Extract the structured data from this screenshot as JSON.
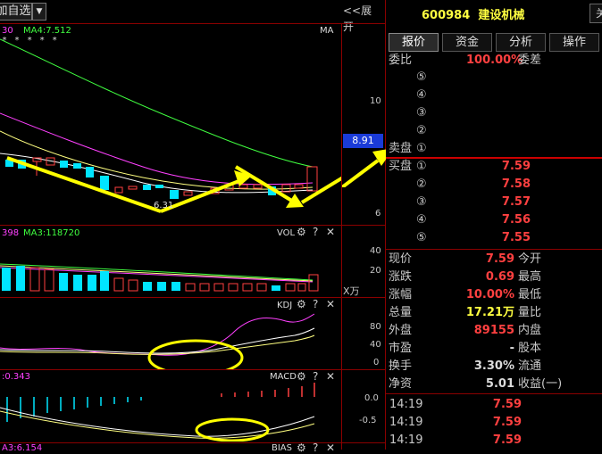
{
  "toolbar": {
    "watchlist_label": "加自选",
    "dropdown_glyph": "▼",
    "expand_label": "<<展开"
  },
  "stock": {
    "code": "600984",
    "name": "建设机械",
    "corner_label": "关"
  },
  "main_chart": {
    "legend_left": "30",
    "legend_ma4": "MA4:7.512",
    "legend_right": "MA",
    "stars": "*   *   * * *",
    "y_ticks": [
      "10",
      "6"
    ],
    "price_badge": "8.91",
    "low_label": "6.31"
  },
  "vol_panel": {
    "legend_left": "398",
    "legend_ma3": "MA3:118720",
    "name": "VOL",
    "y_ticks": [
      "40",
      "20"
    ],
    "unit": "X万"
  },
  "kdj_panel": {
    "name": "KDJ",
    "y_ticks": [
      "80",
      "40",
      "0"
    ]
  },
  "macd_panel": {
    "legend_left": ":0.343",
    "name": "MACD",
    "y_ticks": [
      "0.0",
      "-0.5"
    ]
  },
  "bias_panel": {
    "legend_left": "A3:6.154",
    "name": "BIAS"
  },
  "tabs": [
    {
      "label": "报价",
      "active": true
    },
    {
      "label": "资金",
      "active": false
    },
    {
      "label": "分析",
      "active": false
    },
    {
      "label": "操作",
      "active": false
    }
  ],
  "order_book": {
    "weibi_label": "委比",
    "weibi_value": "100.00%",
    "weicha_label": "委差",
    "sell_label": "卖盘",
    "buy_label": "买盘",
    "sell_levels": [
      {
        "num": "⑤",
        "price": ""
      },
      {
        "num": "④",
        "price": ""
      },
      {
        "num": "③",
        "price": ""
      },
      {
        "num": "②",
        "price": ""
      },
      {
        "num": "①",
        "price": ""
      }
    ],
    "buy_levels": [
      {
        "num": "①",
        "price": "7.59"
      },
      {
        "num": "②",
        "price": "7.58"
      },
      {
        "num": "③",
        "price": "7.57"
      },
      {
        "num": "④",
        "price": "7.56"
      },
      {
        "num": "⑤",
        "price": "7.55"
      }
    ]
  },
  "quote": {
    "rows": [
      {
        "l1": "现价",
        "v1": "7.59",
        "v1c": "red",
        "l2": "今开"
      },
      {
        "l1": "涨跌",
        "v1": "0.69",
        "v1c": "red",
        "l2": "最高"
      },
      {
        "l1": "涨幅",
        "v1": "10.00%",
        "v1c": "red",
        "l2": "最低"
      },
      {
        "l1": "总量",
        "v1": "17.21万",
        "v1c": "yel",
        "l2": "量比"
      },
      {
        "l1": "外盘",
        "v1": "89155",
        "v1c": "red",
        "l2": "内盘"
      },
      {
        "l1": "市盈",
        "v1": "-",
        "v1c": "wht",
        "l2": "股本"
      },
      {
        "l1": "换手",
        "v1": "3.30%",
        "v1c": "wht",
        "l2": "流通"
      },
      {
        "l1": "净资",
        "v1": "5.01",
        "v1c": "wht",
        "l2": "收益(一)"
      }
    ]
  },
  "ticks": [
    {
      "time": "14:19",
      "price": "7.59"
    },
    {
      "time": "14:19",
      "price": "7.59"
    },
    {
      "time": "14:19",
      "price": "7.59"
    }
  ],
  "colors": {
    "up": "#ff4040",
    "down": "#00e5ff",
    "annotation": "#ffff00",
    "grid_divider": "#8b0000"
  }
}
